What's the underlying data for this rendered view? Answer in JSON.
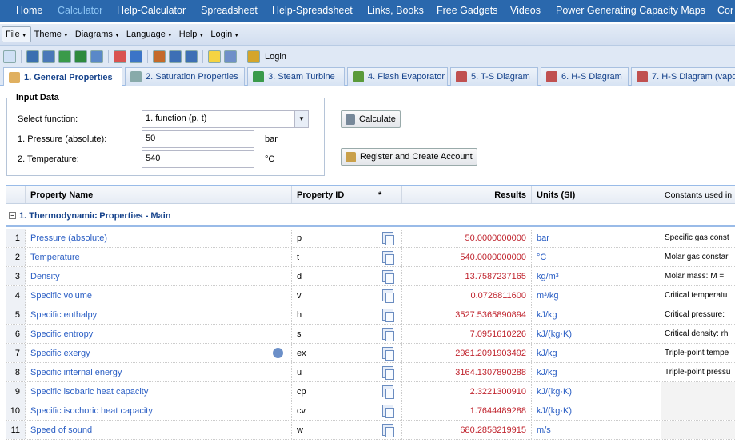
{
  "nav": [
    "Home",
    "Calculator",
    "Help-Calculator",
    "Spreadsheet",
    "Help-Spreadsheet",
    "Links, Books",
    "Free Gadgets",
    "Videos",
    "Power Generating Capacity Maps",
    "Cor"
  ],
  "nav_active": 1,
  "menu": [
    "File",
    "Theme",
    "Diagrams",
    "Language",
    "Help",
    "Login"
  ],
  "toolbar": {
    "login_label": "Login",
    "icons": [
      "new-icon",
      "save-icon",
      "save-as-icon",
      "excel-export-icon",
      "excel-import-icon",
      "save-copy-icon",
      "color-grid-icon",
      "chart-edit-icon",
      "pen-icon",
      "diagram-add-icon",
      "diagram-edit-icon",
      "bulb-icon",
      "help-icon",
      "lock-icon"
    ]
  },
  "tabs": [
    "1. General Properties",
    "2. Saturation Properties",
    "3. Steam Turbine",
    "4. Flash Evaporator",
    "5. T-S Diagram",
    "6. H-S Diagram",
    "7. H-S Diagram (vapo"
  ],
  "input": {
    "legend": "Input Data",
    "select_label": "Select function:",
    "select_value": "1. function (p, t)",
    "p_label": "1. Pressure (absolute):",
    "p_value": "50",
    "p_unit": "bar",
    "t_label": "2. Temperature:",
    "t_value": "540",
    "t_unit": "°C"
  },
  "buttons": {
    "calculate": "Calculate",
    "register": "Register and Create Account"
  },
  "grid": {
    "headers": [
      "",
      "Property Name",
      "Property ID",
      "*",
      "Results",
      "Units (SI)",
      "Constants used in"
    ],
    "group": "1. Thermodynamic Properties - Main",
    "rows": [
      {
        "n": "1",
        "name": "Pressure (absolute)",
        "id": "p",
        "result": "50.0000000000",
        "unit": "bar",
        "const": "Specific gas const"
      },
      {
        "n": "2",
        "name": "Temperature",
        "id": "t",
        "result": "540.0000000000",
        "unit": "°C",
        "const": "Molar gas constar"
      },
      {
        "n": "3",
        "name": "Density",
        "id": "d",
        "result": "13.7587237165",
        "unit": "kg/m³",
        "const": "Molar mass: M ="
      },
      {
        "n": "4",
        "name": "Specific volume",
        "id": "v",
        "result": "0.0726811600",
        "unit": "m³/kg",
        "const": "Critical temperatu"
      },
      {
        "n": "5",
        "name": "Specific enthalpy",
        "id": "h",
        "result": "3527.5365890894",
        "unit": "kJ/kg",
        "const": "Critical pressure:"
      },
      {
        "n": "6",
        "name": "Specific entropy",
        "id": "s",
        "result": "7.0951610226",
        "unit": "kJ/(kg·K)",
        "const": "Critical density: rh"
      },
      {
        "n": "7",
        "name": "Specific exergy",
        "id": "ex",
        "result": "2981.2091903492",
        "unit": "kJ/kg",
        "const": "Triple-point tempe"
      },
      {
        "n": "8",
        "name": "Specific internal energy",
        "id": "u",
        "result": "3164.1307890288",
        "unit": "kJ/kg",
        "const": "Triple-point pressu"
      },
      {
        "n": "9",
        "name": "Specific isobaric heat capacity",
        "id": "cp",
        "result": "2.3221300910",
        "unit": "kJ/(kg·K)",
        "const": ""
      },
      {
        "n": "10",
        "name": "Specific isochoric heat capacity",
        "id": "cv",
        "result": "1.7644489288",
        "unit": "kJ/(kg·K)",
        "const": ""
      },
      {
        "n": "11",
        "name": "Speed of sound",
        "id": "w",
        "result": "680.2858219915",
        "unit": "m/s",
        "const": ""
      }
    ]
  }
}
